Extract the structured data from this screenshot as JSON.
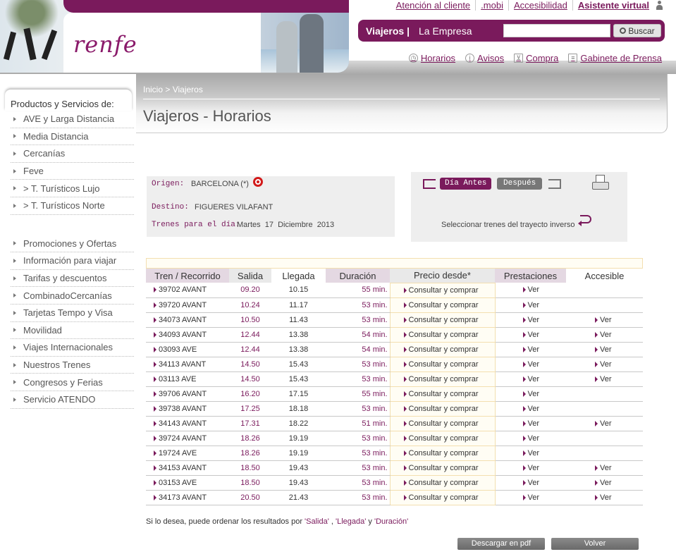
{
  "header": {
    "logo": "renfe",
    "top_links": [
      "Atención al cliente",
      ".mobi",
      "Accesibilidad",
      "Asistente virtual"
    ],
    "nav": {
      "viajeros": "Viajeros |",
      "empresa": "La Empresa",
      "search_value": "",
      "search_button": "Buscar"
    },
    "sub_links": [
      "Horarios",
      "Avisos",
      "Compra",
      "Gabinete de Prensa"
    ]
  },
  "sidebar": {
    "title": "Productos y Servicios de:",
    "group1": [
      "AVE y Larga Distancia",
      "Media Distancia",
      "Cercanías",
      "Feve",
      "> T. Turísticos Lujo",
      "> T. Turísticos Norte"
    ],
    "group2": [
      "Promociones y Ofertas",
      "Información para viajar",
      "Tarifas y descuentos",
      "CombinadoCercanías",
      "Tarjetas Tempo y Visa",
      "Movilidad",
      "Viajes Internacionales",
      "Nuestros Trenes",
      "Congresos y Ferias",
      "Servicio ATENDO"
    ]
  },
  "content": {
    "breadcrumb": "Inicio > Viajeros",
    "title": "Viajeros - Horarios"
  },
  "info": {
    "origen_label": "Origen:",
    "origen_value": "BARCELONA (*)",
    "destino_label": "Destino:",
    "destino_value": "FIGUERES VILAFANT",
    "fecha_label": "Trenes para el día:",
    "fecha_value": "Martes  17  Diciembre  2013"
  },
  "navbox": {
    "dia_antes": "Día Antes",
    "despues": "Después",
    "inverso": "Seleccionar trenes del trayecto inverso"
  },
  "table": {
    "headers": [
      "Tren / Recorrido",
      "Salida",
      "Llegada",
      "Duración",
      "Precio desde*",
      "Prestaciones",
      "Accesible"
    ],
    "rows": [
      {
        "tren": "39702 AVANT",
        "salida": "09.20",
        "llegada": "10.15",
        "duracion": "55 min.",
        "precio": "Consultar y comprar",
        "prest": "Ver",
        "acc": ""
      },
      {
        "tren": "39720 AVANT",
        "salida": "10.24",
        "llegada": "11.17",
        "duracion": "53 min.",
        "precio": "Consultar y comprar",
        "prest": "Ver",
        "acc": ""
      },
      {
        "tren": "34073 AVANT",
        "salida": "10.50",
        "llegada": "11.43",
        "duracion": "53 min.",
        "precio": "Consultar y comprar",
        "prest": "Ver",
        "acc": "Ver"
      },
      {
        "tren": "34093 AVANT",
        "salida": "12.44",
        "llegada": "13.38",
        "duracion": "54 min.",
        "precio": "Consultar y comprar",
        "prest": "Ver",
        "acc": "Ver"
      },
      {
        "tren": "03093 AVE",
        "salida": "12.44",
        "llegada": "13.38",
        "duracion": "54 min.",
        "precio": "Consultar y comprar",
        "prest": "Ver",
        "acc": "Ver"
      },
      {
        "tren": "34113 AVANT",
        "salida": "14.50",
        "llegada": "15.43",
        "duracion": "53 min.",
        "precio": "Consultar y comprar",
        "prest": "Ver",
        "acc": "Ver"
      },
      {
        "tren": "03113 AVE",
        "salida": "14.50",
        "llegada": "15.43",
        "duracion": "53 min.",
        "precio": "Consultar y comprar",
        "prest": "Ver",
        "acc": "Ver"
      },
      {
        "tren": "39706 AVANT",
        "salida": "16.20",
        "llegada": "17.15",
        "duracion": "55 min.",
        "precio": "Consultar y comprar",
        "prest": "Ver",
        "acc": ""
      },
      {
        "tren": "39738 AVANT",
        "salida": "17.25",
        "llegada": "18.18",
        "duracion": "53 min.",
        "precio": "Consultar y comprar",
        "prest": "Ver",
        "acc": ""
      },
      {
        "tren": "34143 AVANT",
        "salida": "17.31",
        "llegada": "18.22",
        "duracion": "51 min.",
        "precio": "Consultar y comprar",
        "prest": "Ver",
        "acc": "Ver"
      },
      {
        "tren": "39724 AVANT",
        "salida": "18.26",
        "llegada": "19.19",
        "duracion": "53 min.",
        "precio": "Consultar y comprar",
        "prest": "Ver",
        "acc": ""
      },
      {
        "tren": "19724 AVE",
        "salida": "18.26",
        "llegada": "19.19",
        "duracion": "53 min.",
        "precio": "Consultar y comprar",
        "prest": "Ver",
        "acc": ""
      },
      {
        "tren": "34153 AVANT",
        "salida": "18.50",
        "llegada": "19.43",
        "duracion": "53 min.",
        "precio": "Consultar y comprar",
        "prest": "Ver",
        "acc": "Ver"
      },
      {
        "tren": "03153 AVE",
        "salida": "18.50",
        "llegada": "19.43",
        "duracion": "53 min.",
        "precio": "Consultar y comprar",
        "prest": "Ver",
        "acc": "Ver"
      },
      {
        "tren": "34173 AVANT",
        "salida": "20.50",
        "llegada": "21.43",
        "duracion": "53 min.",
        "precio": "Consultar y comprar",
        "prest": "Ver",
        "acc": "Ver"
      }
    ]
  },
  "sort_note": {
    "prefix": "Si lo desea, puede ordenar los resultados por ",
    "salida": "'Salida'",
    "sep1": " , ",
    "llegada": "'Llegada'",
    "sep2": " y ",
    "duracion": "'Duración'"
  },
  "buttons": {
    "pdf": "Descargar en pdf",
    "volver": "Volver"
  },
  "colors": {
    "brand": "#7a1a5c",
    "accent_red": "#d21a1a"
  }
}
